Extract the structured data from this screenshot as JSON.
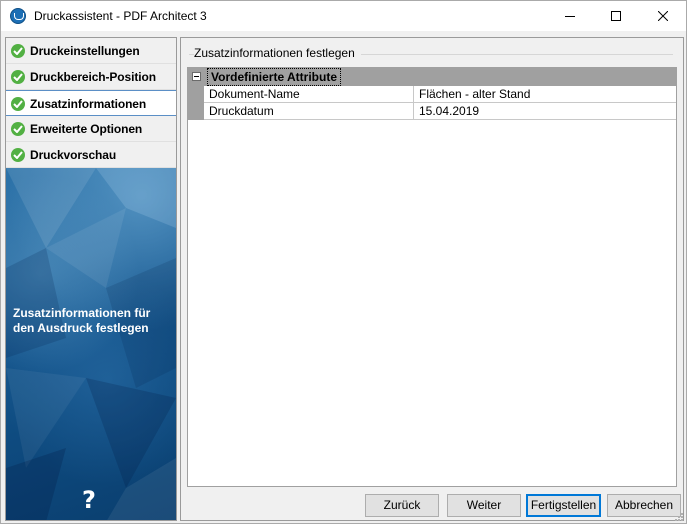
{
  "window": {
    "title": "Druckassistent - PDF Architect 3"
  },
  "nav": {
    "items": [
      {
        "label": "Druckeinstellungen",
        "icon": "check-icon",
        "selected": false
      },
      {
        "label": "Druckbereich-Position",
        "icon": "check-icon",
        "selected": false
      },
      {
        "label": "Zusatzinformationen",
        "icon": "check-icon",
        "selected": true
      },
      {
        "label": "Erweiterte Optionen",
        "icon": "check-icon",
        "selected": false
      },
      {
        "label": "Druckvorschau",
        "icon": "check-icon",
        "selected": false
      }
    ],
    "description": "Zusatzinformationen für den Ausdruck festlegen",
    "help_symbol": "?"
  },
  "main": {
    "group_title": "Zusatzinformationen festlegen",
    "property_grid": {
      "category": "Vordefinierte Attribute",
      "rows": [
        {
          "name": "Dokument-Name",
          "value": "Flächen - alter Stand"
        },
        {
          "name": "Druckdatum",
          "value": "15.04.2019"
        }
      ]
    }
  },
  "buttons": {
    "back": "Zurück",
    "next": "Weiter",
    "finish": "Fertigstellen",
    "cancel": "Abbrechen"
  },
  "colors": {
    "check_green": "#52b043",
    "panel_blue": "#1a5c94",
    "selection_border": "#5b8fc6",
    "default_button_border": "#0078d7"
  }
}
